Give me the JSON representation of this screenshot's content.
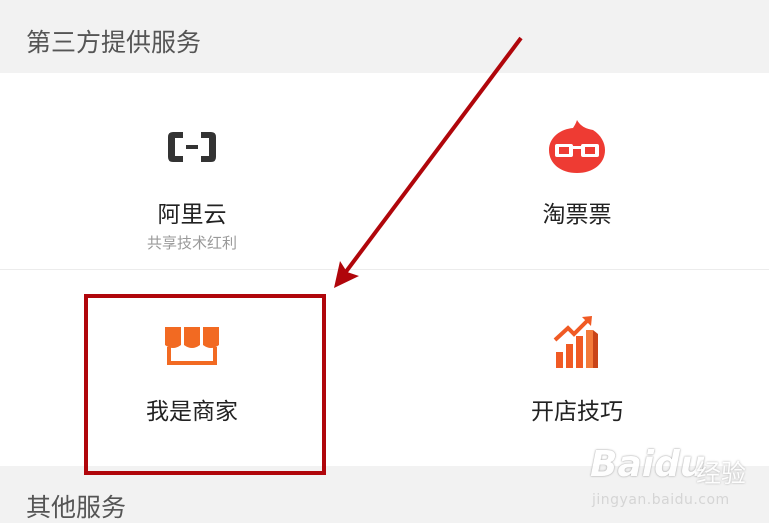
{
  "sections": {
    "third_party": {
      "title": "第三方提供服务"
    },
    "other": {
      "title": "其他服务"
    }
  },
  "services": {
    "aliyun": {
      "name": "阿里云",
      "desc": "共享技术红利",
      "icon": "aliyun-logo-icon",
      "color": "#333333"
    },
    "taopiaopiao": {
      "name": "淘票票",
      "icon": "taopiaopiao-glasses-icon",
      "color": "#ee3b33"
    },
    "merchant": {
      "name": "我是商家",
      "icon": "shop-awning-icon",
      "color": "#f26a22"
    },
    "shop_tips": {
      "name": "开店技巧",
      "icon": "growth-chart-icon",
      "color": "#f05a24"
    }
  },
  "annotation": {
    "box_color": "#b0060b",
    "arrow_color": "#b0060b"
  },
  "watermark": {
    "logo": "Baidu",
    "cn": "经验",
    "url": "jingyan.baidu.com"
  }
}
